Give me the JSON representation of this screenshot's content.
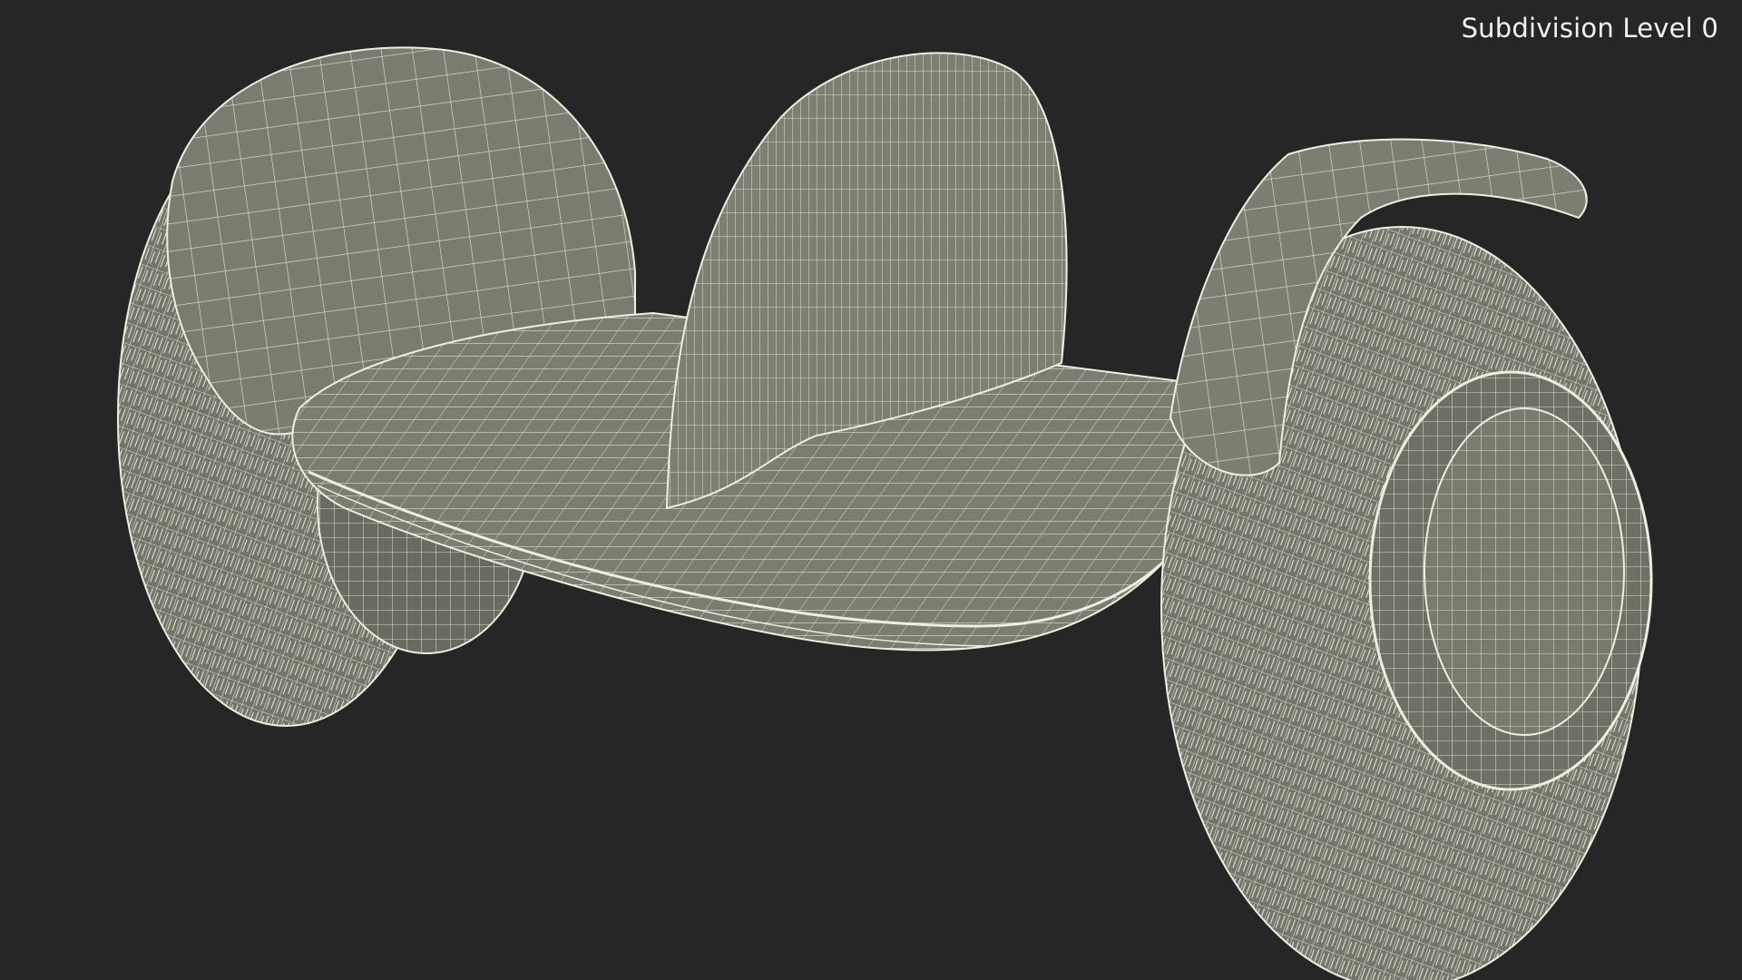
{
  "viewport": {
    "overlay_label": "Subdivision Level 0",
    "background_color": "#262626",
    "surface_color": "#7a7b6f",
    "wire_color": "#efede0"
  },
  "model": {
    "subject": "self-balancing scooter wireframe",
    "render_style": "wireframe-on-shaded"
  }
}
